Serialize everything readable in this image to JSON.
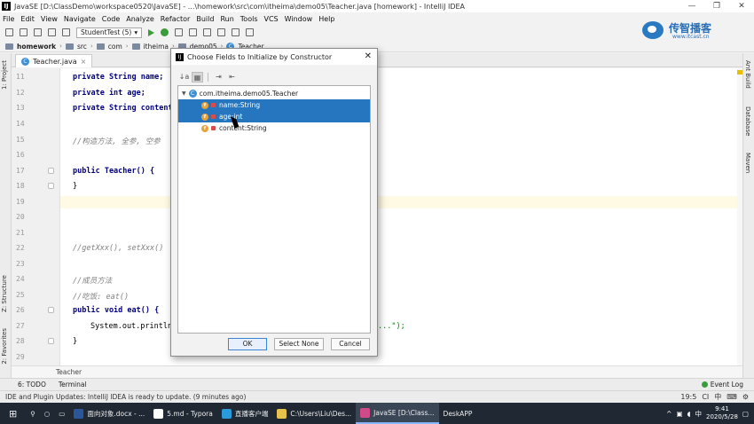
{
  "window": {
    "title": "JavaSE [D:\\ClassDemo\\workspace0520\\JavaSE] - ...\\homework\\src\\com\\itheima\\demo05\\Teacher.java [homework] - IntelliJ IDEA",
    "controls": [
      "—",
      "❐",
      "✕"
    ]
  },
  "menu": [
    "File",
    "Edit",
    "View",
    "Navigate",
    "Code",
    "Analyze",
    "Refactor",
    "Build",
    "Run",
    "Tools",
    "VCS",
    "Window",
    "Help"
  ],
  "toolbar": {
    "run_config": "StudentTest (5)"
  },
  "logo": {
    "name": "传智播客",
    "url": "www.itcast.cn"
  },
  "breadcrumb": [
    "homework",
    "src",
    "com",
    "itheima",
    "demo05",
    "Teacher"
  ],
  "left_tabs": [
    "1: Project",
    "Z: Structure",
    "2: Favorites"
  ],
  "right_tabs": [
    "Ant Build",
    "Database",
    "Maven"
  ],
  "editor": {
    "tab": "Teacher.java",
    "lines": [
      {
        "n": "11",
        "code": "private String name;"
      },
      {
        "n": "12",
        "code": "private int age;"
      },
      {
        "n": "13",
        "code": "private String content;"
      },
      {
        "n": "14",
        "code": ""
      },
      {
        "n": "15",
        "code": "//构造方法, 全参, 空参"
      },
      {
        "n": "16",
        "code": ""
      },
      {
        "n": "17",
        "code": "public Teacher() {"
      },
      {
        "n": "18",
        "code": "}"
      },
      {
        "n": "19",
        "code": ""
      },
      {
        "n": "20",
        "code": ""
      },
      {
        "n": "21",
        "code": ""
      },
      {
        "n": "22",
        "code": "//getXxx(), setXxx()"
      },
      {
        "n": "23",
        "code": ""
      },
      {
        "n": "24",
        "code": "//成员方法"
      },
      {
        "n": "25",
        "code": "//吃饭: eat()"
      },
      {
        "n": "26",
        "code": "public void eat() {"
      },
      {
        "n": "27",
        "code": "System.out.println"
      },
      {
        "n": "28",
        "code": "}"
      },
      {
        "n": "29",
        "code": ""
      }
    ],
    "line27_tail": "...\");",
    "class_crumb": "Teacher"
  },
  "dialog": {
    "title": "Choose Fields to Initialize by Constructor",
    "close": "✕",
    "tools": [
      "↓a",
      "▦",
      "⇥",
      "⇤"
    ],
    "root": "com.itheima.demo05.Teacher",
    "fields": [
      {
        "label": "name:String",
        "selected": true
      },
      {
        "label": "age:int",
        "selected": true
      },
      {
        "label": "content:String",
        "selected": false
      }
    ],
    "buttons": {
      "ok": "OK",
      "select_none": "Select None",
      "cancel": "Cancel"
    }
  },
  "bottom_tabs": {
    "todo": "6: TODO",
    "terminal": "Terminal",
    "event_log": "Event Log"
  },
  "status": {
    "message": "IDE and Plugin Updates: IntelliJ IDEA is ready to update. (9 minutes ago)",
    "position": "19:5",
    "encoding_short": "CI",
    "ime": "中"
  },
  "taskbar": {
    "items": [
      {
        "label": "面向对象.docx - ...",
        "color": "#2b579a"
      },
      {
        "label": "5.md - Typora",
        "color": "#ffffff"
      },
      {
        "label": "直播客户端",
        "color": "#2a9bd8"
      },
      {
        "label": "C:\\Users\\Liu\\Des...",
        "color": "#e8c34a"
      },
      {
        "label": "JavaSE [D:\\Class...",
        "color": "#d04a8a",
        "active": true
      },
      {
        "label": "DeskAPP",
        "color": ""
      }
    ],
    "ime": "中",
    "time": "9:41",
    "date": "2020/5/28"
  }
}
